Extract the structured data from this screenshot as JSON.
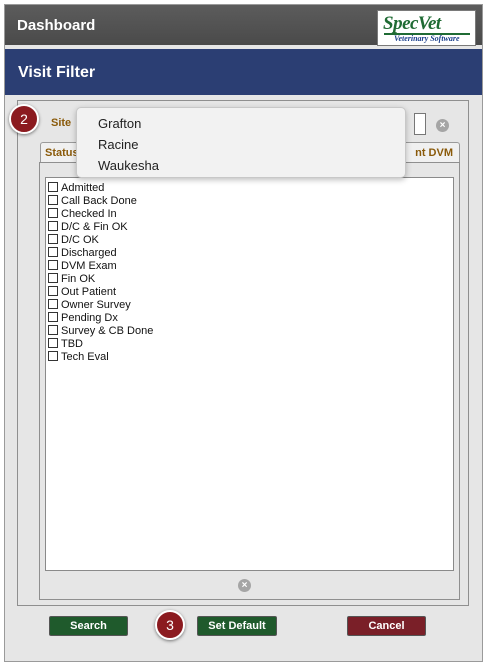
{
  "header": {
    "title": "Dashboard",
    "logo_brand": "SpecVet",
    "logo_tagline": "Veterinary Software"
  },
  "dialog": {
    "title": "Visit Filter"
  },
  "filter": {
    "site_label": "Site",
    "site_options": [
      "Grafton",
      "Racine",
      "Waukesha"
    ],
    "tabs": [
      "Status",
      "nt DVM"
    ],
    "status_items": [
      "Admitted",
      "Call Back Done",
      "Checked In",
      "D/C & Fin OK",
      "D/C OK",
      "Discharged",
      "DVM Exam",
      "Fin OK",
      "Out Patient",
      "Owner Survey",
      "Pending Dx",
      "Survey & CB Done",
      "TBD",
      "Tech Eval"
    ]
  },
  "buttons": {
    "search": "Search",
    "set_default": "Set Default",
    "cancel": "Cancel"
  },
  "steps": {
    "site_step": "2",
    "default_step": "3"
  },
  "icons": {
    "clear": "clear-circle-icon"
  },
  "colors": {
    "title_bar": "#2b3e73",
    "primary_button": "#1f5a2c",
    "cancel_button": "#7a1f28",
    "step_marker": "#8b1a1f",
    "label_text": "#8a5a0a"
  }
}
